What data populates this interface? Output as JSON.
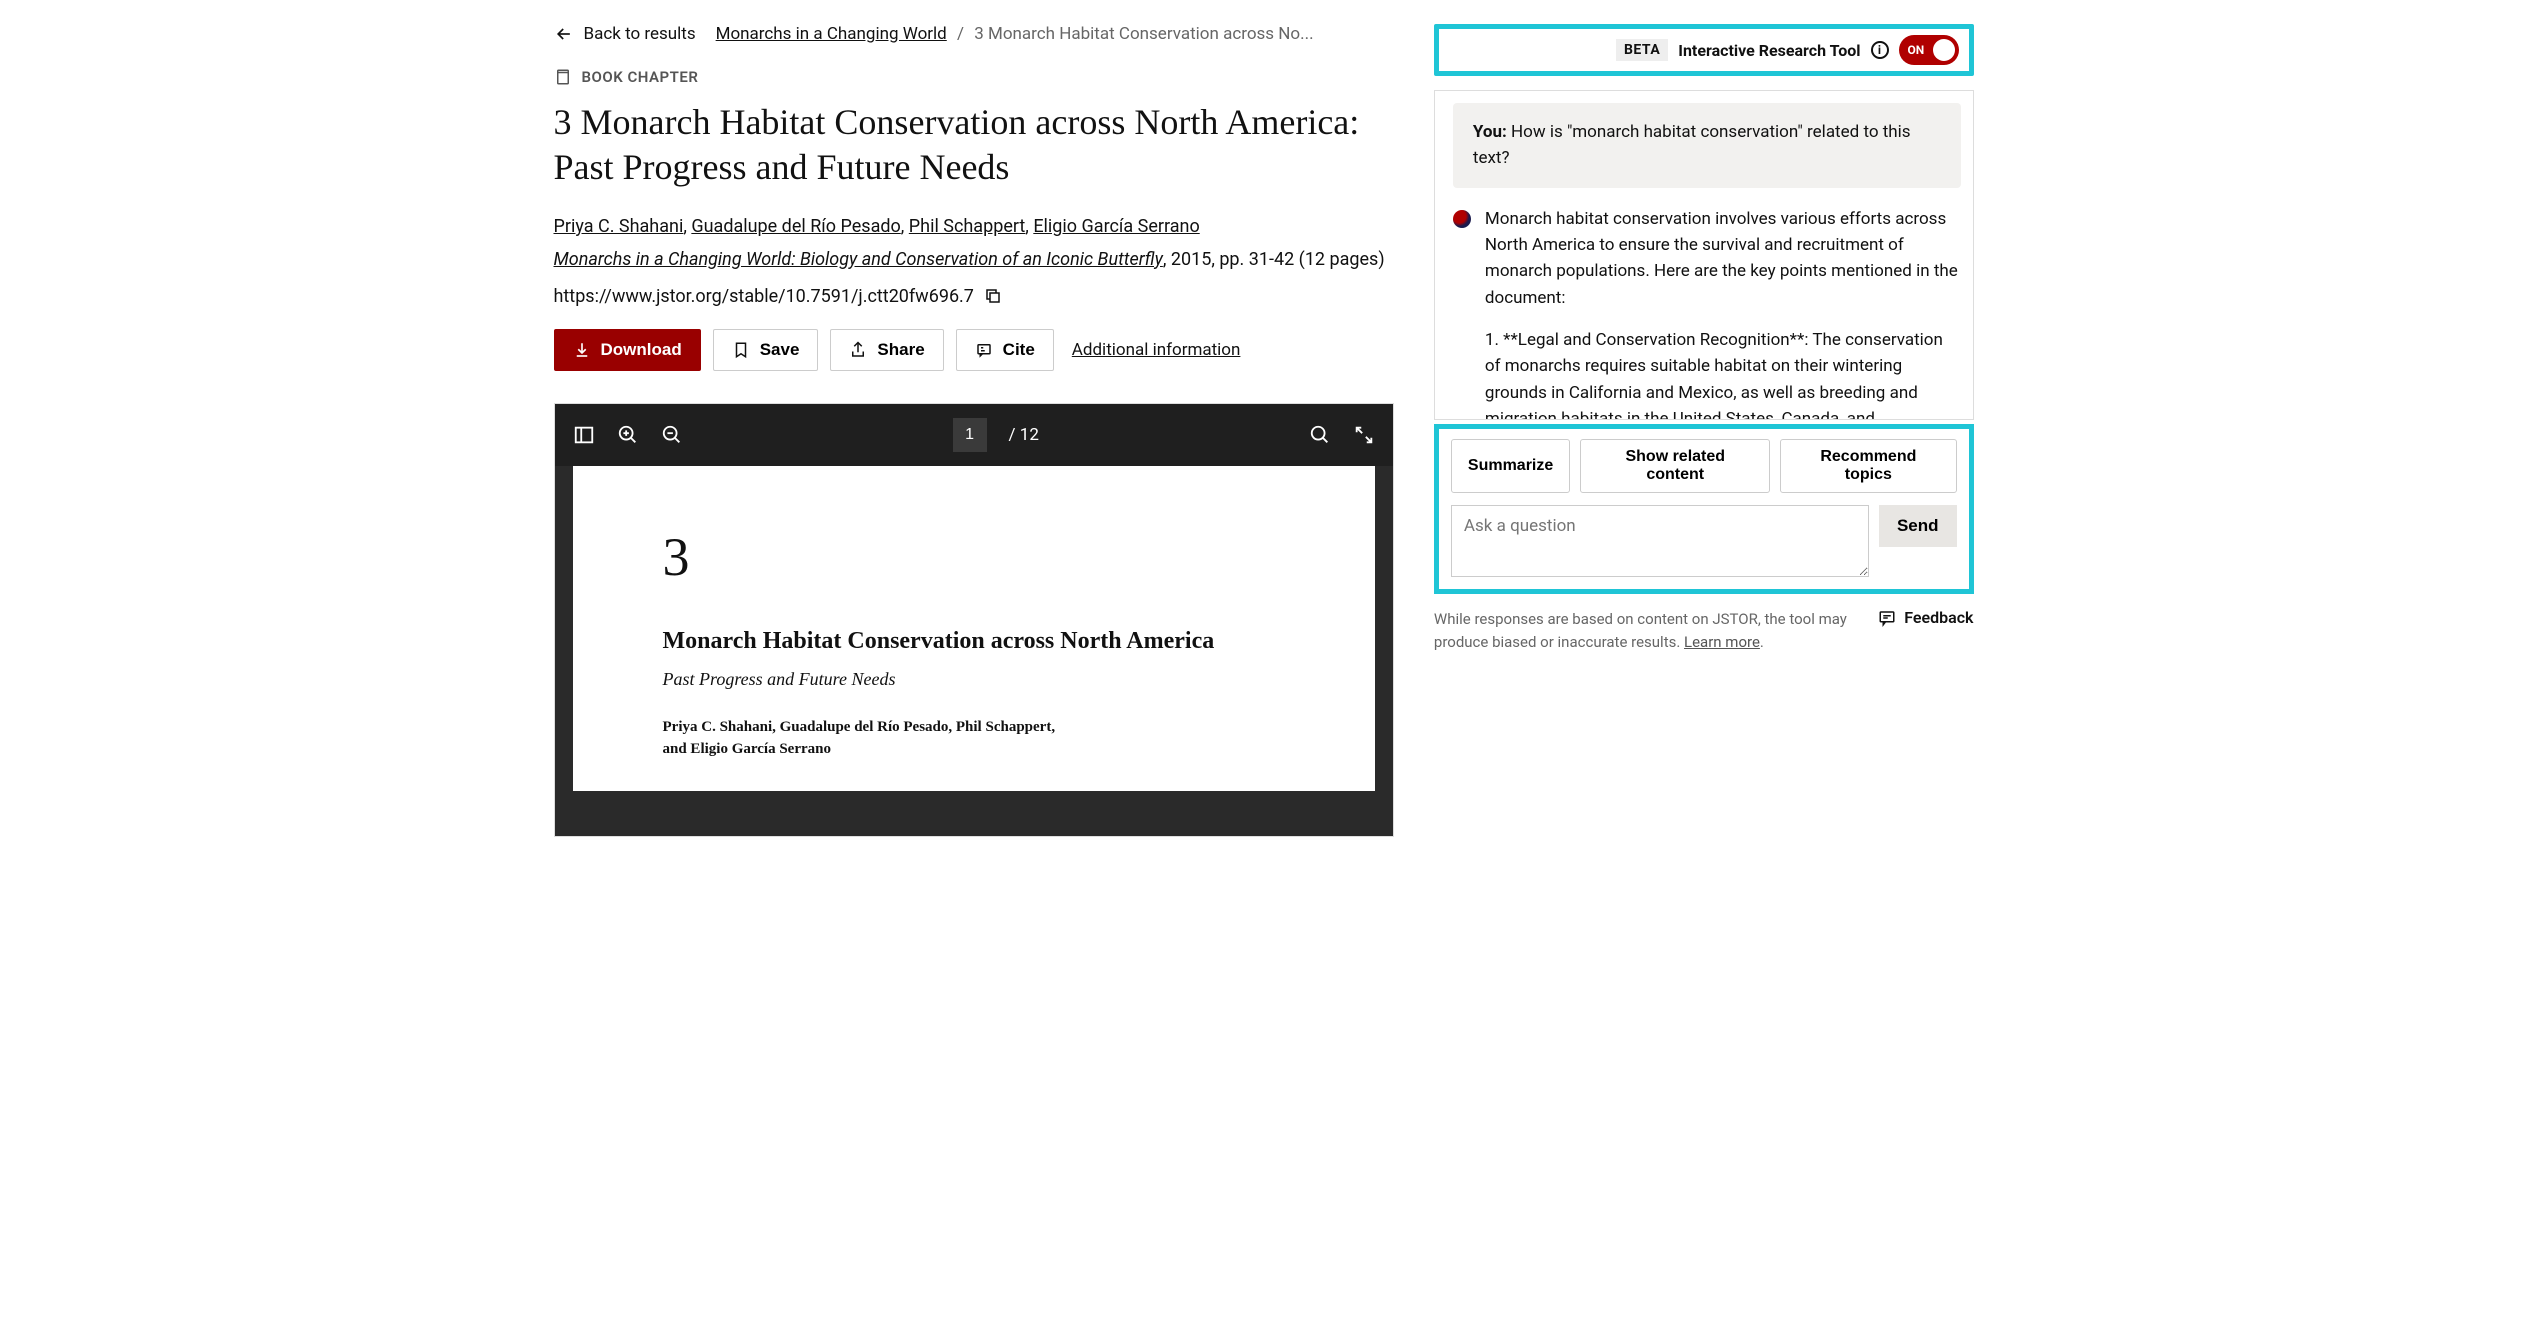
{
  "nav": {
    "back": "Back to results",
    "crumb_parent": "Monarchs in a Changing World",
    "crumb_current": "3 Monarch Habitat Conservation across No..."
  },
  "doc": {
    "type_label": "BOOK CHAPTER",
    "title": "3 Monarch Habitat Conservation across North America: Past Progress and Future Needs",
    "authors": [
      "Priya C. Shahani",
      "Guadalupe del Río Pesado",
      "Phil Schappert",
      "Eligio García Serrano"
    ],
    "source_title": "Monarchs in a Changing World: Biology and Conservation of an Iconic Butterfly",
    "source_meta": ", 2015, pp. 31-42 (12 pages)",
    "url": "https://www.jstor.org/stable/10.7591/j.ctt20fw696.7"
  },
  "actions": {
    "download": "Download",
    "save": "Save",
    "share": "Share",
    "cite": "Cite",
    "additional": "Additional information"
  },
  "viewer": {
    "page_current": "1",
    "page_total": "/ 12",
    "page": {
      "chapter_number": "3",
      "title": "Monarch Habitat Conservation across North America",
      "subtitle": "Past Progress and Future Needs",
      "authors_line1": "Priya C. Shahani, Guadalupe del Río Pesado, Phil Schappert,",
      "authors_line2": "and Eligio García Serrano"
    }
  },
  "tool": {
    "beta": "BETA",
    "label": "Interactive Research Tool",
    "toggle": "ON"
  },
  "chat": {
    "user_prefix": "You:",
    "user_msg": "How is \"monarch habitat conservation\" related to this text?",
    "ai_p1": "Monarch habitat conservation involves various efforts across North America to ensure the survival and recruitment of monarch populations. Here are the key points mentioned in the document:",
    "ai_p2": "1. **Legal and Conservation Recognition**: The conservation of monarchs requires suitable habitat on their wintering grounds in California and Mexico, as well as breeding and migration habitats in the United States, Canada, and"
  },
  "prompts": {
    "summarize": "Summarize",
    "related": "Show related content",
    "recommend": "Recommend topics",
    "placeholder": "Ask a question",
    "send": "Send"
  },
  "footer": {
    "disclaimer_a": "While responses are based on content on JSTOR, the tool may produce biased or inaccurate results. ",
    "learn_more": "Learn more",
    "feedback": "Feedback"
  }
}
